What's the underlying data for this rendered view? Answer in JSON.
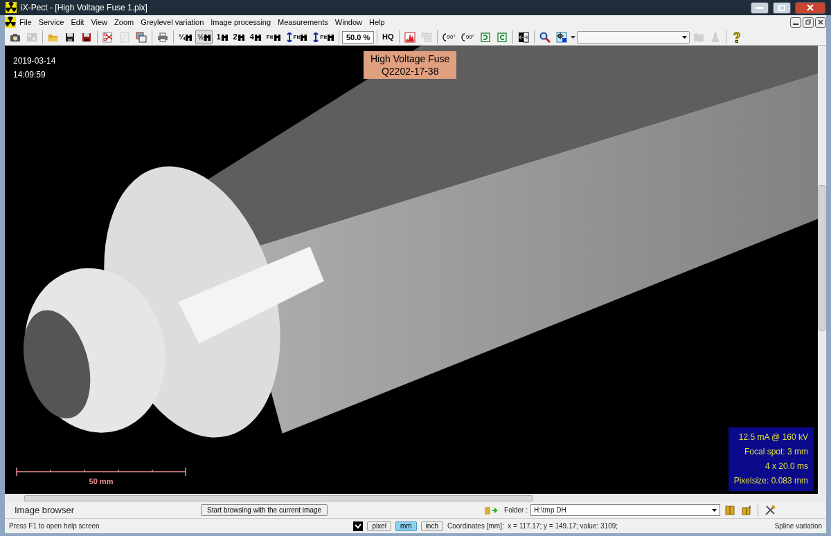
{
  "window": {
    "title": "iX-Pect - [High Voltage Fuse 1.pix]"
  },
  "menu": [
    {
      "label": "File"
    },
    {
      "label": "Service"
    },
    {
      "label": "Edit"
    },
    {
      "label": "View"
    },
    {
      "label": "Zoom"
    },
    {
      "label": "Greylevel variation"
    },
    {
      "label": "Image processing"
    },
    {
      "label": "Measurements"
    },
    {
      "label": "Window"
    },
    {
      "label": "Help"
    }
  ],
  "toolbar": [
    {
      "kind": "icon",
      "disabled": false
    },
    {
      "kind": "icon",
      "disabled": true
    },
    {
      "kind": "separator"
    },
    {
      "kind": "icon",
      "disabled": false
    },
    {
      "kind": "icon",
      "disabled": false
    },
    {
      "kind": "icon",
      "disabled": false
    },
    {
      "kind": "separator"
    },
    {
      "kind": "icon",
      "disabled": false
    },
    {
      "kind": "icon",
      "disabled": true
    },
    {
      "kind": "icon",
      "disabled": false
    },
    {
      "kind": "separator"
    },
    {
      "kind": "icon",
      "disabled": false
    },
    {
      "kind": "separator"
    },
    {
      "kind": "zoom",
      "label": "¼",
      "selected": false
    },
    {
      "kind": "zoom",
      "label": "½",
      "selected": true
    },
    {
      "kind": "zoom",
      "label": "1",
      "selected": false
    },
    {
      "kind": "zoom",
      "label": "2",
      "selected": false
    },
    {
      "kind": "zoom",
      "label": "4",
      "selected": false
    },
    {
      "kind": "zoom",
      "label": "Fit",
      "selected": false
    },
    {
      "kind": "fit",
      "label": "Fit",
      "selected": false
    },
    {
      "kind": "fit",
      "label": "Fit",
      "selected": false
    },
    {
      "kind": "separator"
    },
    {
      "kind": "field",
      "value": "50.0 %"
    },
    {
      "kind": "separator"
    },
    {
      "kind": "text",
      "label": "HQ"
    },
    {
      "kind": "separator"
    },
    {
      "kind": "icon",
      "disabled": false
    },
    {
      "kind": "icon",
      "disabled": true
    },
    {
      "kind": "separator"
    },
    {
      "kind": "rotate",
      "label": "90°"
    },
    {
      "kind": "rotate",
      "label": "90°"
    },
    {
      "kind": "icon",
      "disabled": false
    },
    {
      "kind": "icon",
      "disabled": false
    },
    {
      "kind": "separator"
    },
    {
      "kind": "icon",
      "disabled": false
    },
    {
      "kind": "separator"
    },
    {
      "kind": "icon",
      "disabled": false
    },
    {
      "kind": "icon",
      "disabled": false
    },
    {
      "kind": "combo"
    },
    {
      "kind": "icon",
      "disabled": true
    },
    {
      "kind": "icon",
      "disabled": true
    },
    {
      "kind": "separator"
    },
    {
      "kind": "icon",
      "disabled": false
    }
  ],
  "image": {
    "date": "2019-03-14",
    "time": "14:09:59",
    "label": [
      "High Voltage Fuse",
      "Q2202-17-38"
    ],
    "scale": "50 mm",
    "info": [
      "12.5 mA @ 160 kV",
      "Focal spot: 3 mm",
      "4 x 20.0 ms",
      "Pixelsize: 0.083 mm"
    ]
  },
  "image_browser": {
    "title": "Image browser",
    "button": "Start browsing with the current image",
    "folder_label": "Folder :",
    "folder": "H:\\tmp DH"
  },
  "status_bar": {
    "hint": "Press F1 to open help screen",
    "checked": true,
    "units": [
      {
        "label": "pixel",
        "selected": false
      },
      {
        "label": "mm",
        "selected": true
      },
      {
        "label": "inch",
        "selected": false
      }
    ],
    "coordinates": "Coordinates [mm]:  x = 117.17; y = 149.17; value: 3109;",
    "mode": "Spline variation"
  }
}
